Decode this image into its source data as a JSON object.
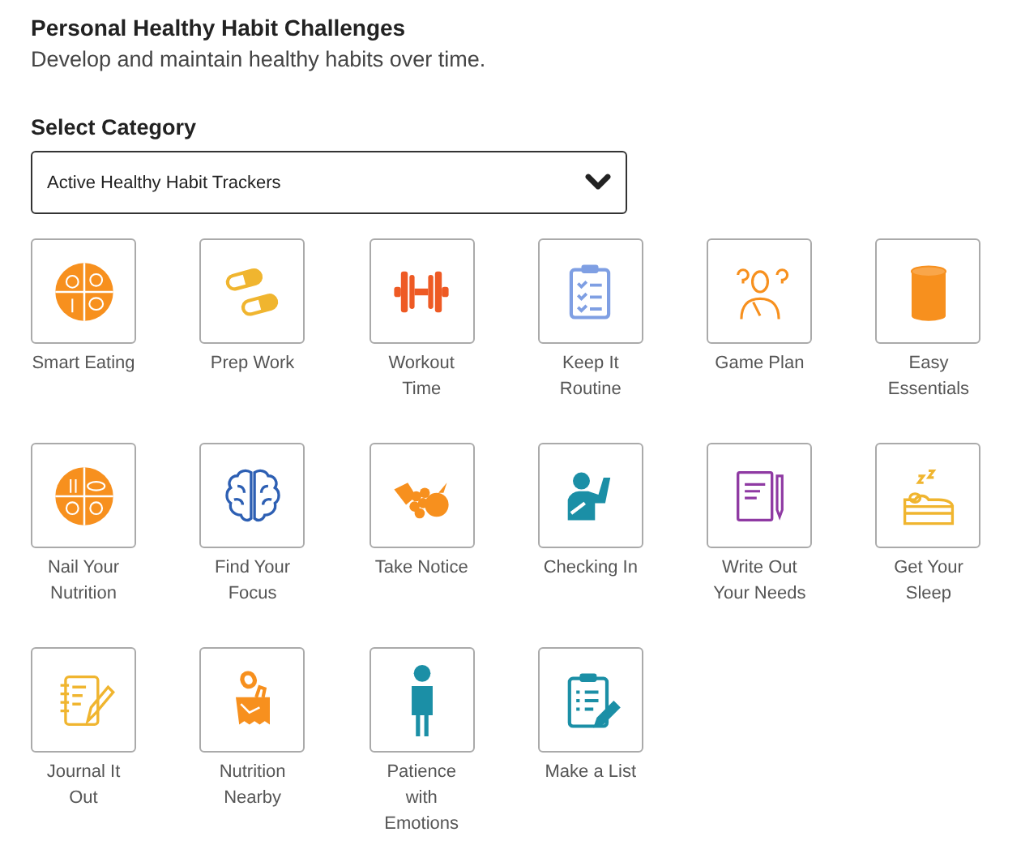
{
  "header": {
    "title": "Personal Healthy Habit Challenges",
    "subtitle": "Develop and maintain healthy habits over time."
  },
  "category": {
    "label": "Select Category",
    "value": "Active Healthy Habit Trackers"
  },
  "habits": [
    {
      "label": "Smart Eating"
    },
    {
      "label": "Prep Work"
    },
    {
      "label": "Workout Time"
    },
    {
      "label": "Keep It Routine"
    },
    {
      "label": "Game Plan"
    },
    {
      "label": "Easy Essentials"
    },
    {
      "label": "Nail Your Nutrition"
    },
    {
      "label": "Find Your Focus"
    },
    {
      "label": "Take Notice"
    },
    {
      "label": "Checking In"
    },
    {
      "label": "Write Out Your Needs"
    },
    {
      "label": "Get Your Sleep"
    },
    {
      "label": "Journal It Out"
    },
    {
      "label": "Nutrition Nearby"
    },
    {
      "label": "Patience with Emotions"
    },
    {
      "label": "Make a List"
    }
  ]
}
